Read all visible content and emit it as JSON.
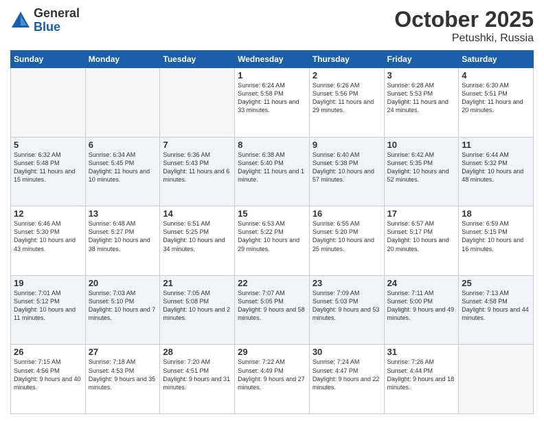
{
  "header": {
    "logo_general": "General",
    "logo_blue": "Blue",
    "month": "October 2025",
    "location": "Petushki, Russia"
  },
  "weekdays": [
    "Sunday",
    "Monday",
    "Tuesday",
    "Wednesday",
    "Thursday",
    "Friday",
    "Saturday"
  ],
  "weeks": [
    [
      {
        "day": "",
        "sunrise": "",
        "sunset": "",
        "daylight": "",
        "empty": true
      },
      {
        "day": "",
        "sunrise": "",
        "sunset": "",
        "daylight": "",
        "empty": true
      },
      {
        "day": "",
        "sunrise": "",
        "sunset": "",
        "daylight": "",
        "empty": true
      },
      {
        "day": "1",
        "sunrise": "Sunrise: 6:24 AM",
        "sunset": "Sunset: 5:58 PM",
        "daylight": "Daylight: 11 hours and 33 minutes.",
        "empty": false
      },
      {
        "day": "2",
        "sunrise": "Sunrise: 6:26 AM",
        "sunset": "Sunset: 5:56 PM",
        "daylight": "Daylight: 11 hours and 29 minutes.",
        "empty": false
      },
      {
        "day": "3",
        "sunrise": "Sunrise: 6:28 AM",
        "sunset": "Sunset: 5:53 PM",
        "daylight": "Daylight: 11 hours and 24 minutes.",
        "empty": false
      },
      {
        "day": "4",
        "sunrise": "Sunrise: 6:30 AM",
        "sunset": "Sunset: 5:51 PM",
        "daylight": "Daylight: 11 hours and 20 minutes.",
        "empty": false
      }
    ],
    [
      {
        "day": "5",
        "sunrise": "Sunrise: 6:32 AM",
        "sunset": "Sunset: 5:48 PM",
        "daylight": "Daylight: 11 hours and 15 minutes.",
        "empty": false
      },
      {
        "day": "6",
        "sunrise": "Sunrise: 6:34 AM",
        "sunset": "Sunset: 5:45 PM",
        "daylight": "Daylight: 11 hours and 10 minutes.",
        "empty": false
      },
      {
        "day": "7",
        "sunrise": "Sunrise: 6:36 AM",
        "sunset": "Sunset: 5:43 PM",
        "daylight": "Daylight: 11 hours and 6 minutes.",
        "empty": false
      },
      {
        "day": "8",
        "sunrise": "Sunrise: 6:38 AM",
        "sunset": "Sunset: 5:40 PM",
        "daylight": "Daylight: 11 hours and 1 minute.",
        "empty": false
      },
      {
        "day": "9",
        "sunrise": "Sunrise: 6:40 AM",
        "sunset": "Sunset: 5:38 PM",
        "daylight": "Daylight: 10 hours and 57 minutes.",
        "empty": false
      },
      {
        "day": "10",
        "sunrise": "Sunrise: 6:42 AM",
        "sunset": "Sunset: 5:35 PM",
        "daylight": "Daylight: 10 hours and 52 minutes.",
        "empty": false
      },
      {
        "day": "11",
        "sunrise": "Sunrise: 6:44 AM",
        "sunset": "Sunset: 5:32 PM",
        "daylight": "Daylight: 10 hours and 48 minutes.",
        "empty": false
      }
    ],
    [
      {
        "day": "12",
        "sunrise": "Sunrise: 6:46 AM",
        "sunset": "Sunset: 5:30 PM",
        "daylight": "Daylight: 10 hours and 43 minutes.",
        "empty": false
      },
      {
        "day": "13",
        "sunrise": "Sunrise: 6:48 AM",
        "sunset": "Sunset: 5:27 PM",
        "daylight": "Daylight: 10 hours and 38 minutes.",
        "empty": false
      },
      {
        "day": "14",
        "sunrise": "Sunrise: 6:51 AM",
        "sunset": "Sunset: 5:25 PM",
        "daylight": "Daylight: 10 hours and 34 minutes.",
        "empty": false
      },
      {
        "day": "15",
        "sunrise": "Sunrise: 6:53 AM",
        "sunset": "Sunset: 5:22 PM",
        "daylight": "Daylight: 10 hours and 29 minutes.",
        "empty": false
      },
      {
        "day": "16",
        "sunrise": "Sunrise: 6:55 AM",
        "sunset": "Sunset: 5:20 PM",
        "daylight": "Daylight: 10 hours and 25 minutes.",
        "empty": false
      },
      {
        "day": "17",
        "sunrise": "Sunrise: 6:57 AM",
        "sunset": "Sunset: 5:17 PM",
        "daylight": "Daylight: 10 hours and 20 minutes.",
        "empty": false
      },
      {
        "day": "18",
        "sunrise": "Sunrise: 6:59 AM",
        "sunset": "Sunset: 5:15 PM",
        "daylight": "Daylight: 10 hours and 16 minutes.",
        "empty": false
      }
    ],
    [
      {
        "day": "19",
        "sunrise": "Sunrise: 7:01 AM",
        "sunset": "Sunset: 5:12 PM",
        "daylight": "Daylight: 10 hours and 11 minutes.",
        "empty": false
      },
      {
        "day": "20",
        "sunrise": "Sunrise: 7:03 AM",
        "sunset": "Sunset: 5:10 PM",
        "daylight": "Daylight: 10 hours and 7 minutes.",
        "empty": false
      },
      {
        "day": "21",
        "sunrise": "Sunrise: 7:05 AM",
        "sunset": "Sunset: 5:08 PM",
        "daylight": "Daylight: 10 hours and 2 minutes.",
        "empty": false
      },
      {
        "day": "22",
        "sunrise": "Sunrise: 7:07 AM",
        "sunset": "Sunset: 5:05 PM",
        "daylight": "Daylight: 9 hours and 58 minutes.",
        "empty": false
      },
      {
        "day": "23",
        "sunrise": "Sunrise: 7:09 AM",
        "sunset": "Sunset: 5:03 PM",
        "daylight": "Daylight: 9 hours and 53 minutes.",
        "empty": false
      },
      {
        "day": "24",
        "sunrise": "Sunrise: 7:11 AM",
        "sunset": "Sunset: 5:00 PM",
        "daylight": "Daylight: 9 hours and 49 minutes.",
        "empty": false
      },
      {
        "day": "25",
        "sunrise": "Sunrise: 7:13 AM",
        "sunset": "Sunset: 4:58 PM",
        "daylight": "Daylight: 9 hours and 44 minutes.",
        "empty": false
      }
    ],
    [
      {
        "day": "26",
        "sunrise": "Sunrise: 7:15 AM",
        "sunset": "Sunset: 4:56 PM",
        "daylight": "Daylight: 9 hours and 40 minutes.",
        "empty": false
      },
      {
        "day": "27",
        "sunrise": "Sunrise: 7:18 AM",
        "sunset": "Sunset: 4:53 PM",
        "daylight": "Daylight: 9 hours and 35 minutes.",
        "empty": false
      },
      {
        "day": "28",
        "sunrise": "Sunrise: 7:20 AM",
        "sunset": "Sunset: 4:51 PM",
        "daylight": "Daylight: 9 hours and 31 minutes.",
        "empty": false
      },
      {
        "day": "29",
        "sunrise": "Sunrise: 7:22 AM",
        "sunset": "Sunset: 4:49 PM",
        "daylight": "Daylight: 9 hours and 27 minutes.",
        "empty": false
      },
      {
        "day": "30",
        "sunrise": "Sunrise: 7:24 AM",
        "sunset": "Sunset: 4:47 PM",
        "daylight": "Daylight: 9 hours and 22 minutes.",
        "empty": false
      },
      {
        "day": "31",
        "sunrise": "Sunrise: 7:26 AM",
        "sunset": "Sunset: 4:44 PM",
        "daylight": "Daylight: 9 hours and 18 minutes.",
        "empty": false
      },
      {
        "day": "",
        "sunrise": "",
        "sunset": "",
        "daylight": "",
        "empty": true
      }
    ]
  ]
}
